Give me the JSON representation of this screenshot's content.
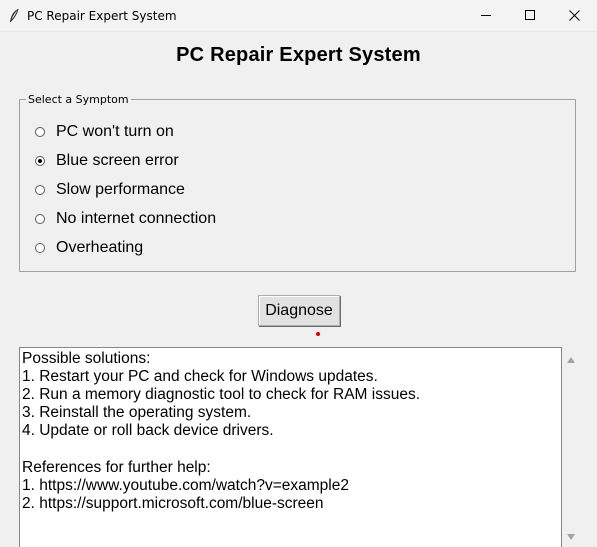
{
  "window": {
    "title": "PC Repair Expert System"
  },
  "heading": "PC Repair Expert System",
  "symptoms": {
    "legend": "Select a Symptom",
    "options": [
      {
        "label": "PC won't turn on",
        "selected": false
      },
      {
        "label": "Blue screen error",
        "selected": true
      },
      {
        "label": "Slow performance",
        "selected": false
      },
      {
        "label": "No internet connection",
        "selected": false
      },
      {
        "label": "Overheating",
        "selected": false
      }
    ]
  },
  "diagnose_button": "Diagnose",
  "result": {
    "lines": [
      "Possible solutions:",
      "1. Restart your PC and check for Windows updates.",
      "2. Run a memory diagnostic tool to check for RAM issues.",
      "3. Reinstall the operating system.",
      "4. Update or roll back device drivers.",
      "",
      "References for further help:",
      "1. https://www.youtube.com/watch?v=example2",
      "2. https://support.microsoft.com/blue-screen"
    ]
  },
  "icons": {
    "app": "feather-icon",
    "minimize": "minimize-icon",
    "maximize": "maximize-icon",
    "close": "close-icon",
    "scroll_up": "scroll-up-arrow-icon",
    "scroll_down": "scroll-down-arrow-icon"
  }
}
